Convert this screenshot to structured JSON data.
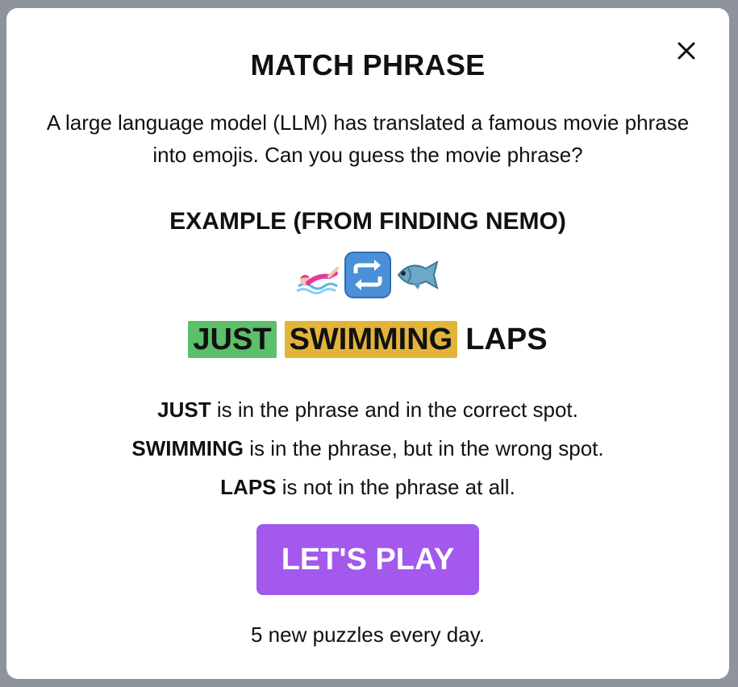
{
  "modal": {
    "title": "MATCH PHRASE",
    "close_icon": "close-icon",
    "intro": "A large language model (LLM) has translated a famous movie phrase into emojis. Can you guess the movie phrase?",
    "example_heading": "EXAMPLE (FROM FINDING NEMO)",
    "emojis": [
      "person-swimming-icon",
      "repeat-arrows-icon",
      "fish-icon"
    ],
    "words": [
      {
        "text": "JUST",
        "status": "correct",
        "color": "#5cbf6a"
      },
      {
        "text": "SWIMMING",
        "status": "present",
        "color": "#e3b43a"
      },
      {
        "text": "LAPS",
        "status": "absent",
        "color": "#ffffff"
      }
    ],
    "rules": [
      {
        "word": "JUST",
        "text": " is in the phrase and in the correct spot."
      },
      {
        "word": "SWIMMING",
        "text": " is in the phrase, but in the wrong spot."
      },
      {
        "word": "LAPS",
        "text": " is not in the phrase at all."
      }
    ],
    "play_button": "LET'S PLAY",
    "play_color": "#a259ec",
    "footer": "5 new puzzles every day."
  }
}
